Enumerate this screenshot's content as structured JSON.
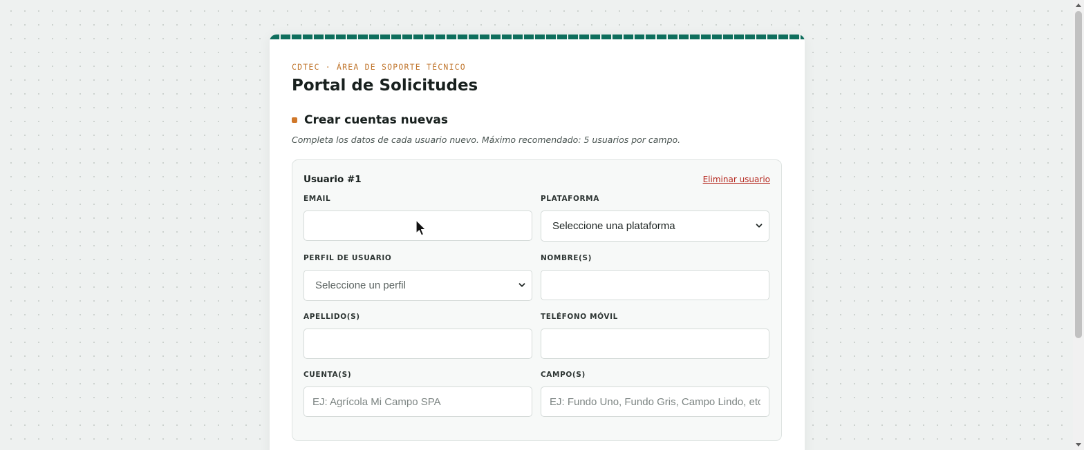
{
  "header": {
    "kicker": "CDTEC · ÁREA DE SOPORTE TÉCNICO",
    "title": "Portal de Solicitudes"
  },
  "section": {
    "title": "Crear cuentas nuevas",
    "description": "Completa los datos de cada usuario nuevo. Máximo recomendado: 5 usuarios por campo."
  },
  "user": {
    "title": "Usuario #1",
    "remove_label": "Eliminar usuario",
    "fields": {
      "email": {
        "label": "EMAIL",
        "value": "",
        "placeholder": ""
      },
      "plataforma": {
        "label": "PLATAFORMA",
        "selected": "Seleccione una plataforma"
      },
      "perfil": {
        "label": "PERFIL DE USUARIO",
        "selected": "Seleccione un perfil"
      },
      "nombres": {
        "label": "NOMBRE(S)",
        "value": "",
        "placeholder": ""
      },
      "apellidos": {
        "label": "APELLIDO(S)",
        "value": "",
        "placeholder": ""
      },
      "telefono": {
        "label": "TELÉFONO MÓVIL",
        "value": "",
        "placeholder": ""
      },
      "cuentas": {
        "label": "CUENTA(S)",
        "value": "",
        "placeholder": "EJ: Agrícola Mi Campo SPA"
      },
      "campos": {
        "label": "CAMPO(S)",
        "value": "",
        "placeholder": "EJ: Fundo Uno, Fundo Gris, Campo Lindo, etc"
      }
    }
  },
  "colors": {
    "brand_green": "#0f6e5d",
    "accent_orange": "#c0752c",
    "danger_red": "#b5281f"
  },
  "icons": {
    "select_arrow": "chevron-down-icon",
    "pointer": "mouse-cursor-icon",
    "section_marker": "square-bullet-icon"
  }
}
